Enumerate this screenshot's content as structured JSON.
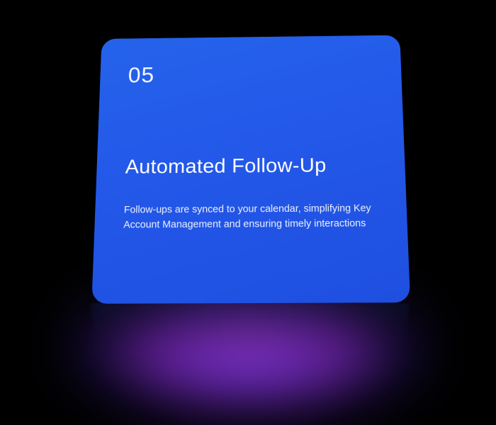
{
  "card": {
    "number": "05",
    "title": "Automated Follow-Up",
    "description": "Follow-ups are synced to your calendar, simplifying Key Account Management and ensuring timely interactions"
  }
}
